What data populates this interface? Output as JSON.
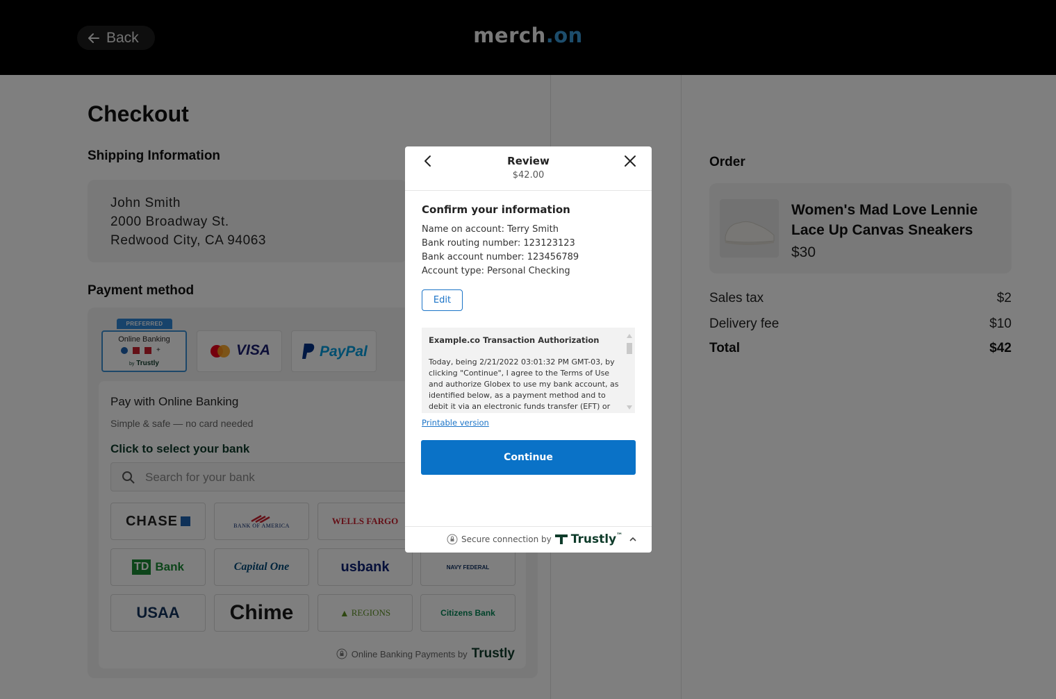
{
  "header": {
    "back_label": "Back",
    "logo_part1": "merch",
    "logo_part2": ".on"
  },
  "checkout": {
    "title": "Checkout",
    "shipping_title": "Shipping Information",
    "shipping": [
      "John Smith",
      "2000 Broadway St.",
      "Redwood City, CA 94063"
    ],
    "payment_title": "Payment method",
    "methods": {
      "preferred_badge": "PREFERRED",
      "online_banking_label": "Online Banking",
      "online_banking_by": "by",
      "trustly_word": "Trustly",
      "visa": "VISA",
      "paypal": "PayPal"
    },
    "online_banking": {
      "title": "Pay with Online Banking",
      "subtitle": "Simple & safe — no card needed",
      "select_label": "Click to select your bank",
      "search_placeholder": "Search for your bank",
      "banks": [
        "CHASE",
        "BANK OF AMERICA",
        "WELLS FARGO",
        "TD Bank",
        "Capital One",
        "usbank",
        "NAVY FEDERAL",
        "USAA",
        "Chime",
        "REGIONS",
        "Citizens Bank"
      ],
      "footer_label": "Online Banking Payments by",
      "footer_brand": "Trustly"
    }
  },
  "order": {
    "title": "Order",
    "item_name": "Women's Mad Love Lennie Lace Up Canvas Sneakers",
    "item_price": "$30",
    "sales_tax_label": "Sales tax",
    "sales_tax": "$2",
    "delivery_label": "Delivery fee",
    "delivery": "$10",
    "total_label": "Total",
    "total": "$42"
  },
  "modal": {
    "title": "Review",
    "amount": "$42.00",
    "heading": "Confirm your information",
    "info": [
      "Name on account: Terry Smith",
      "Bank routing number: 123123123",
      "Bank account number: 123456789",
      "Account type: Personal Checking"
    ],
    "edit_label": "Edit",
    "terms_title": "Example.co Transaction Authorization",
    "terms_body": "Today, being 2/21/2022 03:01:32 PM GMT-03, by clicking \"Continue\", I agree to the Terms of Use and authorize Globex to use my bank account, as identified below, as a payment method and to debit it via an electronic funds transfer (EFT) or",
    "printable_label": "Printable version",
    "continue_label": "Continue",
    "footer_label": "Secure connection by",
    "footer_brand": "Trustly",
    "footer_tm": "™"
  },
  "colors": {
    "primary": "#0a72c7",
    "trustly_green": "#0e3b2a",
    "logo_accent": "#3a9ad9"
  }
}
